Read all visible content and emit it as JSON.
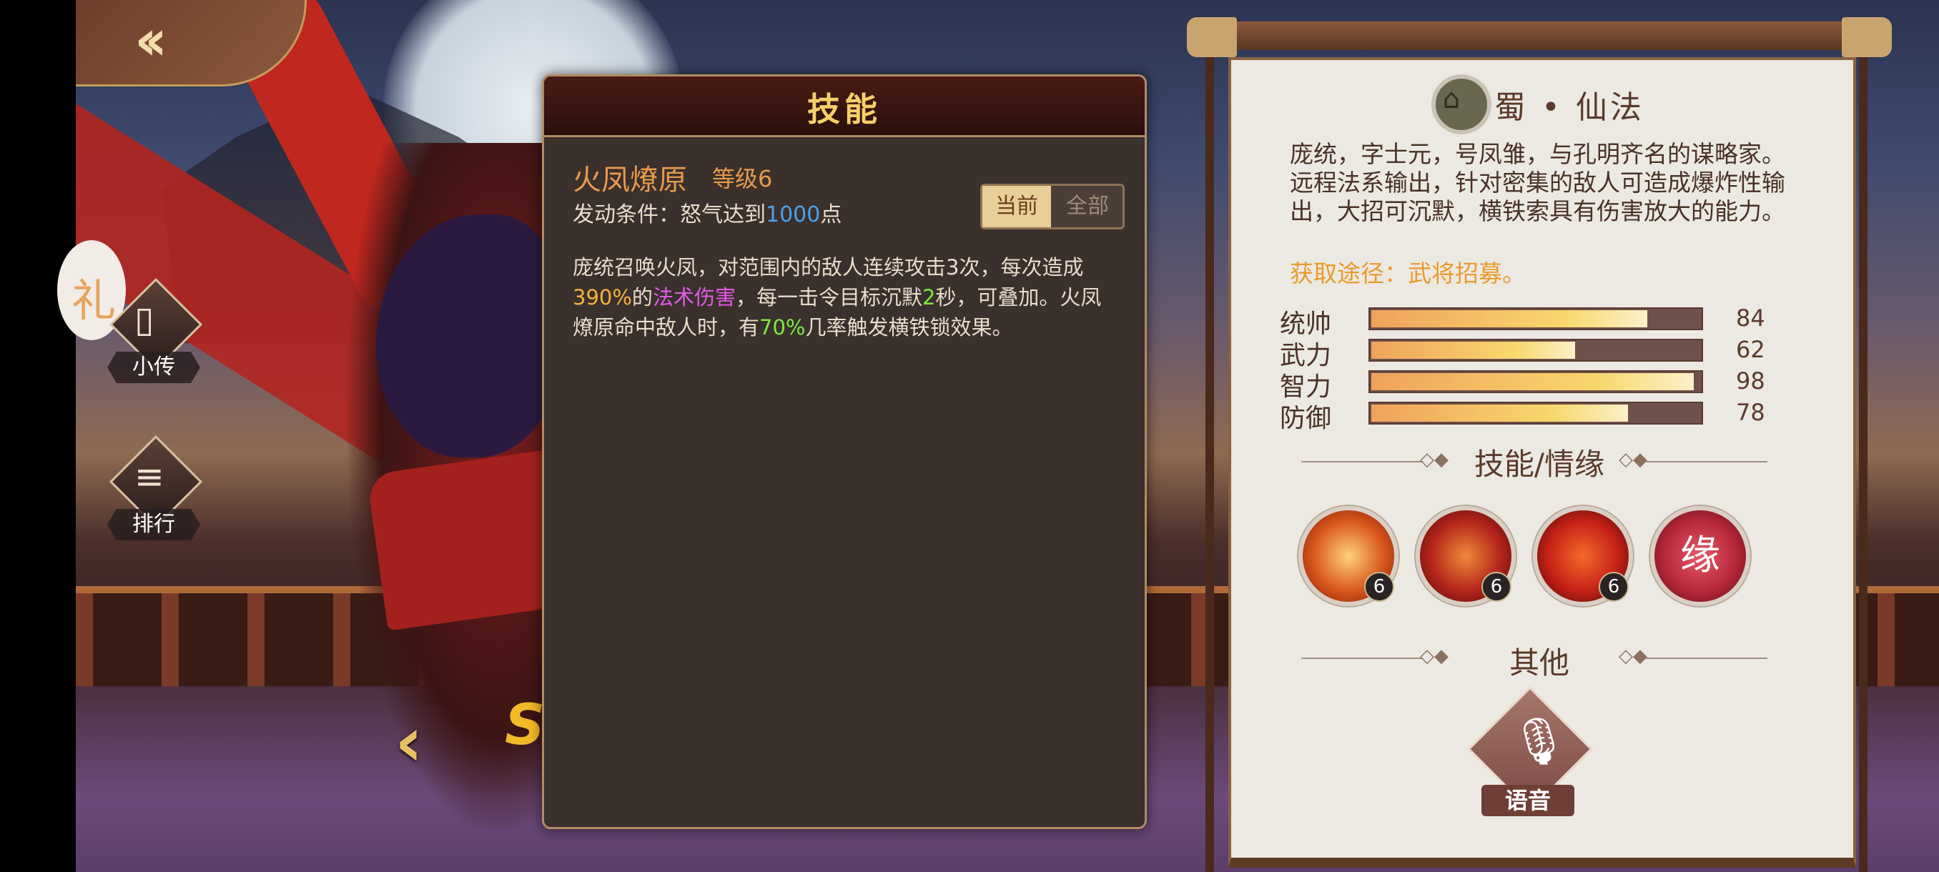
{
  "nav": {
    "back_icon": "back-arrow-icon",
    "left_arrow_icon": "chevron-left-icon",
    "ss_mark": "SS"
  },
  "side_buttons": [
    {
      "label": "小传",
      "icon": "book-icon"
    },
    {
      "label": "排行",
      "icon": "scroll-icon"
    }
  ],
  "skill_panel": {
    "title": "技能",
    "skill_name": "火凤燎原",
    "skill_level": "等级6",
    "condition_prefix": "发动条件：怒气达到",
    "condition_value": "1000",
    "condition_suffix": "点",
    "toggle_current": "当前",
    "toggle_all": "全部",
    "desc": {
      "p1": "庞统召唤火凤，对范围内的敌人连续攻击3次，每次造成",
      "pct1": "390%",
      "p2": "的",
      "dmg_type": "法术伤害",
      "p3": "，每一击令目标沉默",
      "silence": "2",
      "p4": "秒，可叠加。火凤燎原命中敌人时，有",
      "pct2": "70%",
      "p5": "几率触发横铁锁效果。"
    }
  },
  "hero": {
    "faction": "蜀 • 仙法",
    "faction_icon": "shu-emblem-icon",
    "bio": "庞统，字士元，号凤雏，与孔明齐名的谋略家。远程法系输出，针对密集的敌人可造成爆炸性输出，大招可沉默，横铁索具有伤害放大的能力。",
    "acquire": "获取途径：武将招募。",
    "stats": [
      {
        "name": "统帅",
        "value": 84
      },
      {
        "name": "武力",
        "value": 62
      },
      {
        "name": "智力",
        "value": 98
      },
      {
        "name": "防御",
        "value": 78
      }
    ],
    "section_skills": "技能/情缘",
    "skills": [
      {
        "icon": "phoenix-icon",
        "level": "6",
        "color": "#d9561c"
      },
      {
        "icon": "flame-strike-icon",
        "level": "6",
        "color": "#b3231a"
      },
      {
        "icon": "iron-chain-icon",
        "level": "6",
        "color": "#c52016"
      },
      {
        "icon": "fate-heart-icon",
        "level": "",
        "color": "#b7283a",
        "text": "缘"
      }
    ],
    "section_other": "其他",
    "voice_label": "语音",
    "voice_icon": "microphone-icon"
  }
}
